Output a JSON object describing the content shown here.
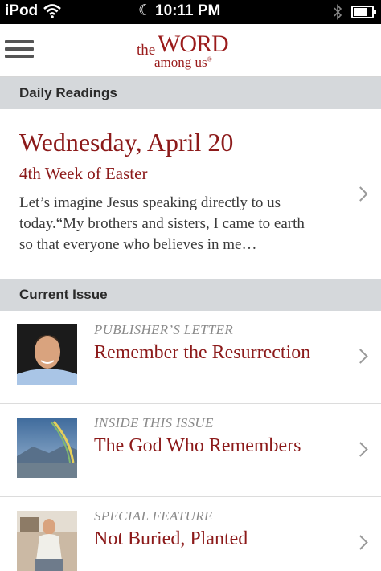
{
  "status_bar": {
    "carrier": "iPod",
    "time": "10:11 PM",
    "icons": [
      "wifi-icon",
      "moon-icon",
      "bluetooth-icon",
      "battery-icon"
    ]
  },
  "nav": {
    "logo_the": "the",
    "logo_word": "WORD",
    "logo_among": "among us",
    "logo_mark": "®",
    "menu_icon": "hamburger-menu-icon"
  },
  "daily_readings": {
    "header": "Daily Readings",
    "date": "Wednesday, April 20",
    "week": "4th Week of Easter",
    "excerpt": "Let’s imagine Jesus speaking directly to us today.“My brothers and sisters, I came to earth so that everyone who believes in me…"
  },
  "current_issue": {
    "header": "Current Issue",
    "articles": [
      {
        "kicker": "PUBLISHER’S LETTER",
        "title": "Remember the Resurrection",
        "thumb": "portrait-photo"
      },
      {
        "kicker": "INSIDE THIS ISSUE",
        "title": "The God Who Remembers",
        "thumb": "rainbow-landscape-photo"
      },
      {
        "kicker": "SPECIAL FEATURE",
        "title": "Not Buried, Planted",
        "thumb": "person-seated-photo"
      }
    ]
  },
  "colors": {
    "accent": "#8c1a1a",
    "section_header_bg": "#d5d8db",
    "kicker": "#8a8a8a"
  }
}
